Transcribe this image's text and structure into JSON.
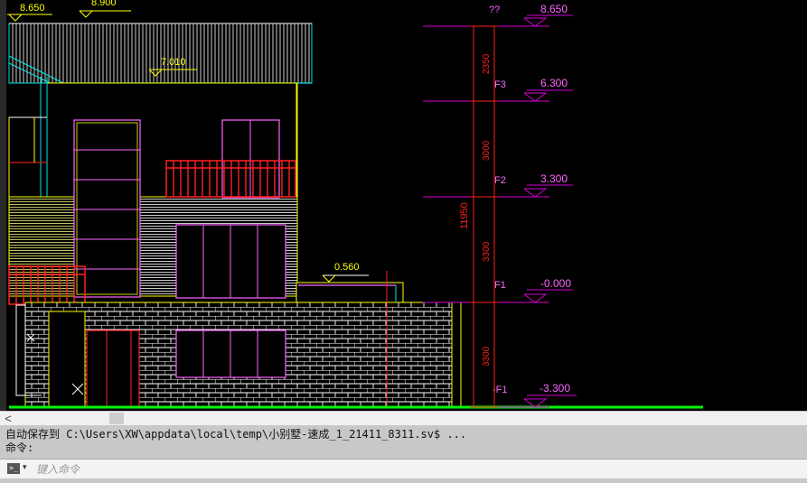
{
  "drawing": {
    "elevations_left": {
      "top": "8.650",
      "top2": "8.900",
      "roof": "7.010",
      "terrace": "0.560"
    },
    "levels": [
      {
        "name": "??",
        "value": "8.650"
      },
      {
        "name": "F3",
        "value": "6.300"
      },
      {
        "name": "F2",
        "value": "3.300"
      },
      {
        "name": "F1",
        "value": "-0.000"
      },
      {
        "name": "-F1",
        "value": "-3.300"
      }
    ],
    "dimensions": {
      "total": "11950",
      "segments": [
        "2350",
        "3000",
        "3300",
        "3300"
      ]
    },
    "colors": {
      "background": "#000000",
      "level_lines": "#d400d4",
      "dimension": "#ff2020",
      "text_yellow": "#ffff00",
      "cyan": "#00e5e5",
      "ground": "#00ff00",
      "white": "#ffffff"
    }
  },
  "command_line": {
    "history_line1": "自动保存到 C:\\Users\\XW\\appdata\\local\\temp\\小别墅-速成_1_21411_8311.sv$ ...",
    "history_line2": "命令:",
    "input_placeholder": "键入命令",
    "prompt_icon": "command-prompt-icon"
  },
  "scrollbar": {
    "left_arrow": "<"
  }
}
